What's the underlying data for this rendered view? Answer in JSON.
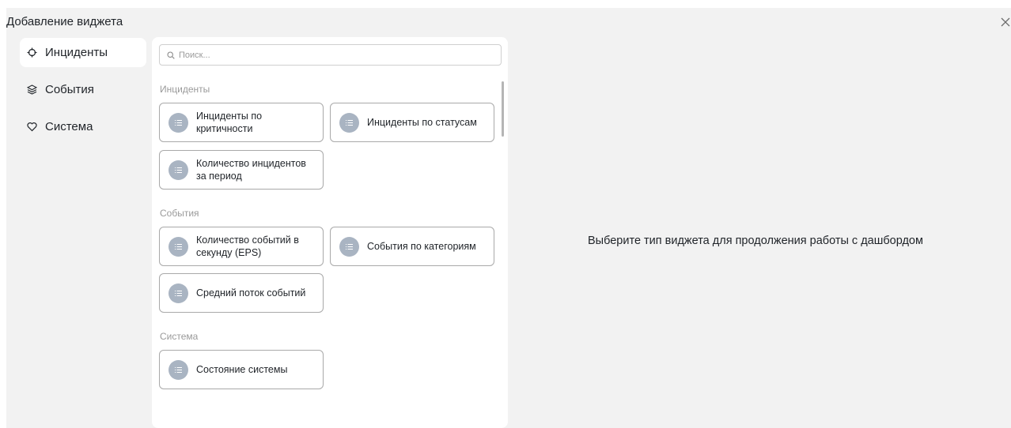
{
  "dialog": {
    "title": "Добавление виджета",
    "close_icon": "close-icon"
  },
  "nav": {
    "items": [
      {
        "label": "Инциденты",
        "icon": "crosshair-icon",
        "active": true
      },
      {
        "label": "События",
        "icon": "layers-icon",
        "active": false
      },
      {
        "label": "Система",
        "icon": "heart-icon",
        "active": false
      }
    ]
  },
  "search": {
    "placeholder": "Поиск...",
    "value": ""
  },
  "sections": [
    {
      "title": "Инциденты",
      "widgets": [
        "Инциденты по критичности",
        "Инциденты по статусам",
        "Количество инцидентов за период"
      ]
    },
    {
      "title": "События",
      "widgets": [
        "Количество событий в секунду (EPS)",
        "События по категориям",
        "Средний поток событий"
      ]
    },
    {
      "title": "Система",
      "widgets": [
        "Состояние системы"
      ]
    }
  ],
  "empty_state": {
    "message": "Выберите тип виджета для продолжения работы с дашбордом"
  },
  "colors": {
    "dialog_bg": "#f2f2f2",
    "badge": "#a9b4c2",
    "card_border": "#a9a9a9",
    "muted_text": "#9a9a9a"
  }
}
